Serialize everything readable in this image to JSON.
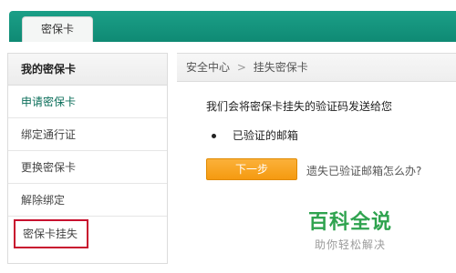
{
  "header": {
    "tab_label": "密保卡"
  },
  "sidebar": {
    "title": "我的密保卡",
    "items": [
      {
        "label": "申请密保卡"
      },
      {
        "label": "绑定通行证"
      },
      {
        "label": "更换密保卡"
      },
      {
        "label": "解除绑定"
      },
      {
        "label": "密保卡挂失"
      }
    ]
  },
  "breadcrumb": {
    "root": "安全中心",
    "separator": ">",
    "current": "挂失密保卡"
  },
  "main": {
    "prompt": "我们会将密保卡挂失的验证码发送给您",
    "option_label": "已验证的邮箱",
    "next_button": "下一步",
    "lost_link": "遗失已验证邮箱怎么办?"
  },
  "watermark": {
    "title": "百科全说",
    "subtitle": "助你轻松解决"
  },
  "colors": {
    "header_green": "#0f8a74",
    "button_orange": "#f59a10",
    "highlight_red": "#c8102e"
  }
}
